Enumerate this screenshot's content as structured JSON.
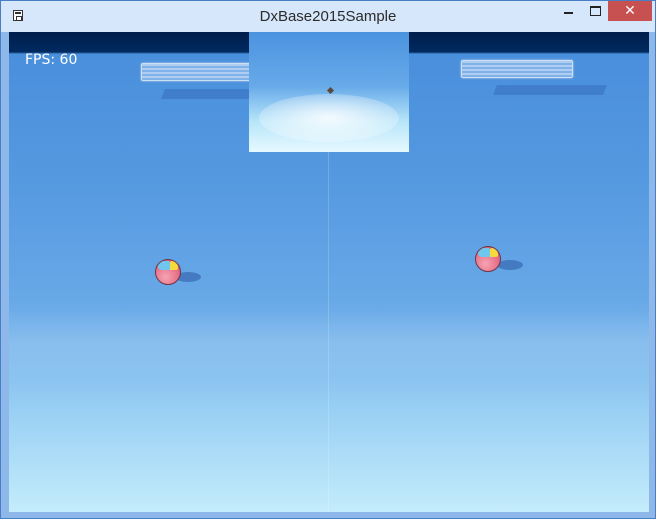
{
  "window": {
    "title": "DxBase2015Sample",
    "close_glyph": "✕"
  },
  "hud": {
    "fps_text": "FPS: 60"
  },
  "icons": [
    "app-icon",
    "minimize-icon",
    "maximize-icon",
    "close-icon"
  ],
  "colors": {
    "titlebar": "#d6e7fb",
    "close_button": "#c75050",
    "sky_top": "#001d4a",
    "ball_body": "#e87188",
    "ball_cap_blue": "#6fc6ef",
    "ball_cap_yellow": "#f6d93c"
  }
}
